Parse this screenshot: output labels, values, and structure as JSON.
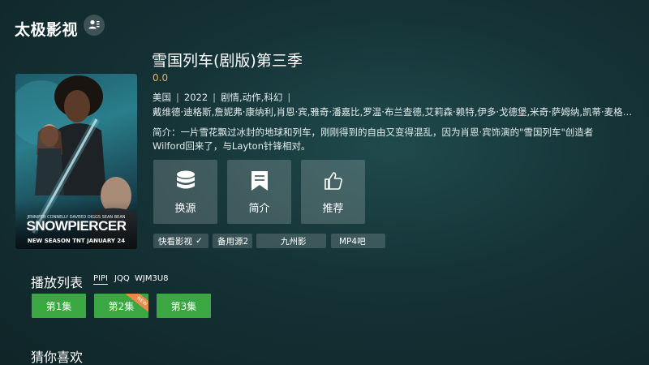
{
  "app": {
    "title": "太极影视"
  },
  "poster": {
    "credits": "JENNIFER CONNELLY   DAVEED DIGGS   SEAN BEAN",
    "logo_text": "SNOWPIERCER",
    "airdate": "NEW SEASON  TNT  JANUARY 24"
  },
  "detail": {
    "title": "雪国列车(剧版)第三季",
    "rating": "0.0",
    "region": "美国",
    "year": "2022",
    "genres": "剧情,动作,科幻",
    "meta_sep": "|",
    "cast": "戴维德·迪格斯,詹妮弗·康纳利,肖恩·宾,雅奇·潘嘉比,罗温·布兰查德,艾莉森·赖特,伊多·戈德堡,米奇·萨姆纳,凯蒂·麦格拉斯",
    "description": "简介：一片雪花飘过冰封的地球和列车，刚刚得到的自由又变得混乱，因为肖恩·宾饰演的\"雪国列车\"创造者Wilford回来了，与Layton针锋相对。"
  },
  "actions": {
    "switch_source": "换源",
    "intro": "简介",
    "recommend": "推荐"
  },
  "sources": {
    "items": [
      "快看影视",
      "备用源2",
      "九州影",
      "MP4吧"
    ],
    "selected_mark": "✓"
  },
  "playlist": {
    "title": "播放列表",
    "tabs": [
      "PIPI",
      "JQQ",
      "WJM3U8"
    ],
    "episodes": [
      "第1集",
      "第2集",
      "第3集"
    ],
    "episode_badge": "NEW"
  },
  "recommend_section": {
    "title": "猜你喜欢"
  },
  "colors": {
    "episode_green": "#3ba742",
    "rating_gold": "#e6b84a",
    "badge_orange": "#e88a4a"
  }
}
